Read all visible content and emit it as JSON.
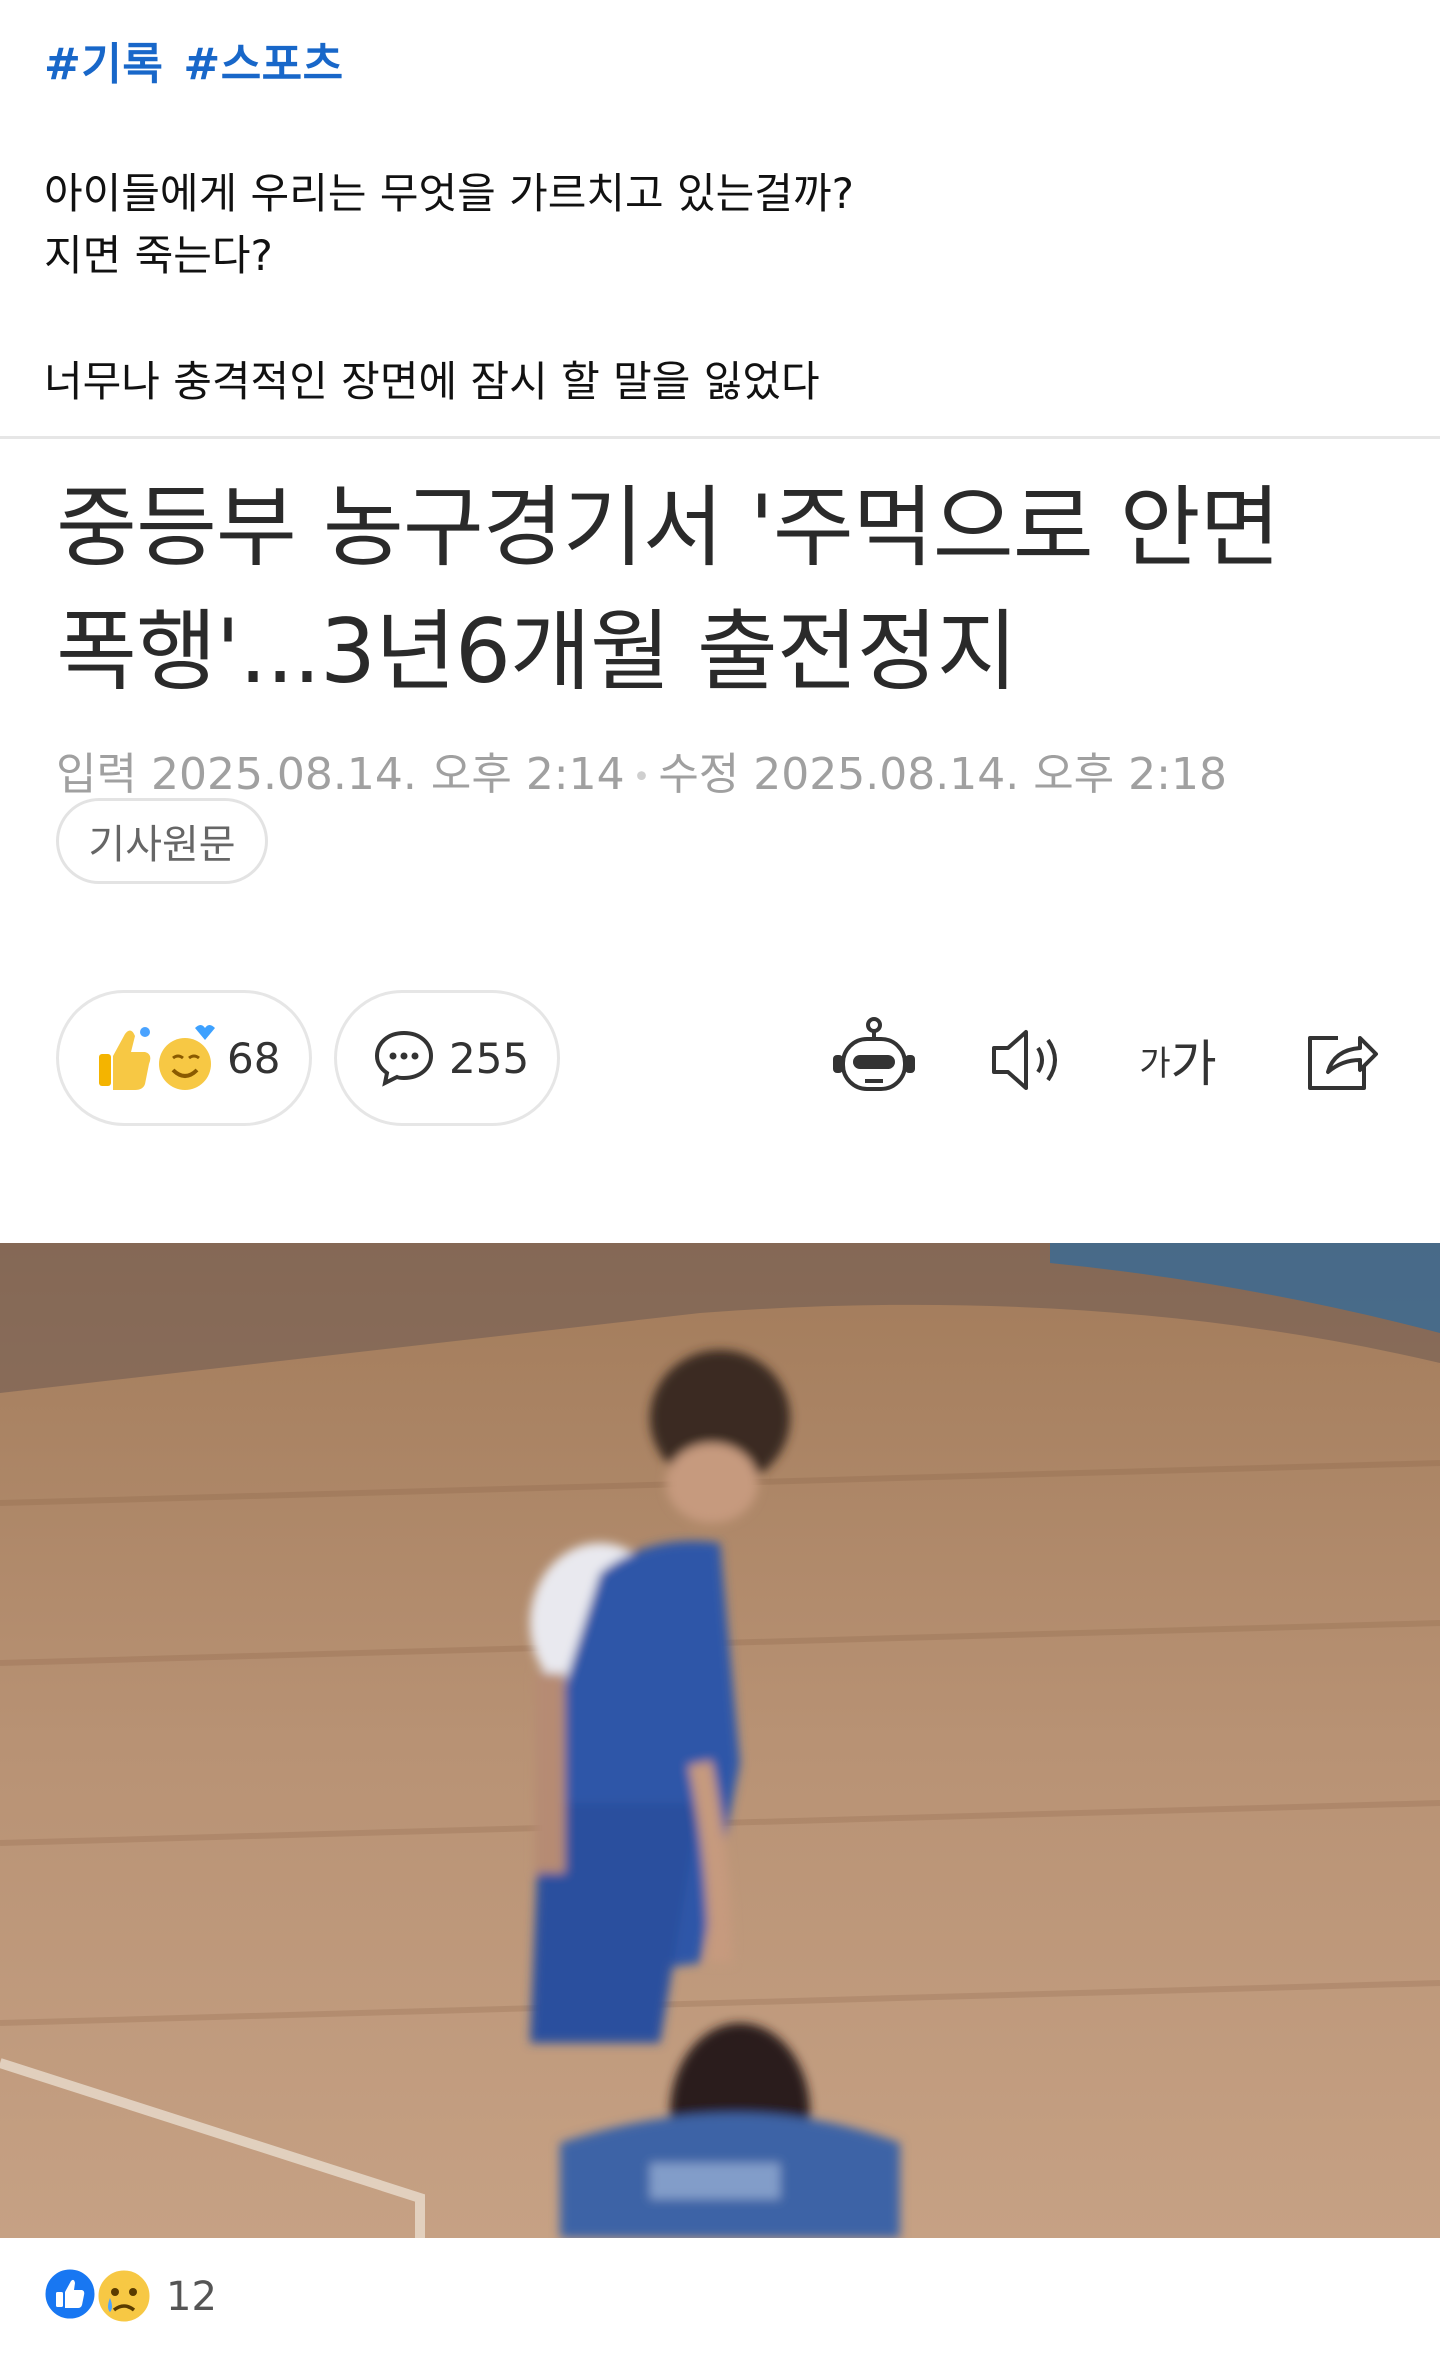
{
  "post": {
    "hashtags": [
      "#기록",
      "#스포츠"
    ],
    "lines": [
      "아이들에게 우리는 무엇을 가르치고 있는걸까?",
      "지면 죽는다?",
      "너무나 충격적인 장면에 잠시 할 말을 잃었다"
    ]
  },
  "article": {
    "headline_line1": "중등부 농구경기서 '주먹으로 안면",
    "headline_line2": "폭행'...3년6개월 출전정지",
    "input_label": "입력",
    "input_time": "2025.08.14. 오후 2:14",
    "edit_label": "수정",
    "edit_time": "2025.08.14. 오후 2:18",
    "original_button": "기사원문",
    "reaction_count": "68",
    "comment_count": "255",
    "fontsize_small": "가",
    "fontsize_large": "가"
  },
  "icons": {
    "reactions": "thumbs-up-smile-emoji",
    "comments": "speech-bubble-icon",
    "summary": "robot-icon",
    "tts": "speaker-icon",
    "share": "share-icon"
  },
  "footer": {
    "reaction_count": "12"
  },
  "colors": {
    "hashtag": "#1867c9",
    "like_blue": "#1877f2",
    "sad_yellow": "#f7c844"
  }
}
